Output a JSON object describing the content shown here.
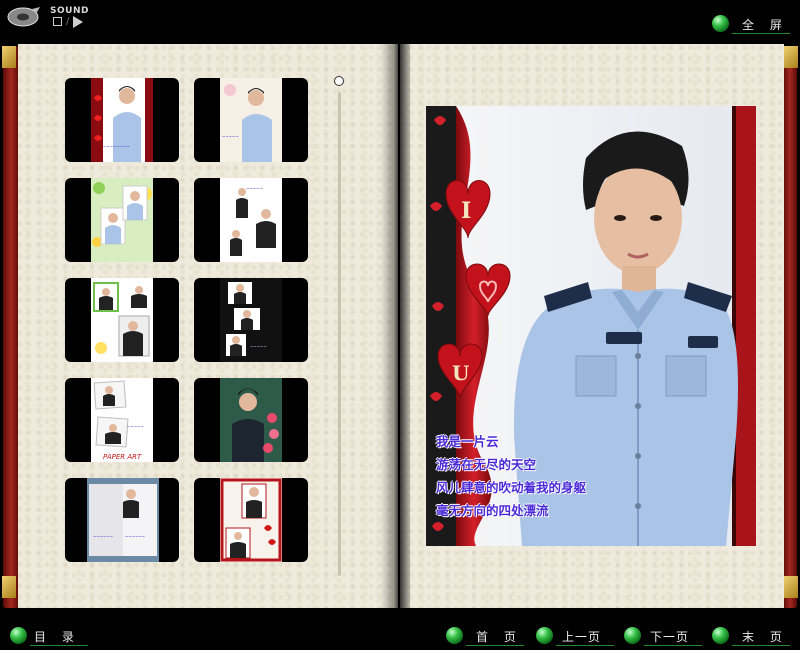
{
  "toolbar": {
    "sound_label": "SOUND",
    "fullscreen_label": "全 屏"
  },
  "gallery": {
    "thumbnails": [
      {
        "name": "thumb-1"
      },
      {
        "name": "thumb-2"
      },
      {
        "name": "thumb-3"
      },
      {
        "name": "thumb-4"
      },
      {
        "name": "thumb-5"
      },
      {
        "name": "thumb-6"
      },
      {
        "name": "thumb-7"
      },
      {
        "name": "thumb-8"
      },
      {
        "name": "thumb-9"
      },
      {
        "name": "thumb-10"
      }
    ],
    "thumb9_caption": "PAPER ART"
  },
  "photo": {
    "badge_letters": [
      "I",
      "U"
    ],
    "poem_lines": [
      "我是一片云",
      "游荡在无尽的天空",
      "风儿肆意的吹动着我的身躯",
      "毫无方向的四处漂流"
    ]
  },
  "nav": {
    "contents_label": "目 录",
    "first_label": "首 页",
    "prev_label": "上一页",
    "next_label": "下一页",
    "last_label": "末 页"
  },
  "colors": {
    "accent_green": "#39c24a",
    "poem_text": "#4a2ad8",
    "frame_red": "#b4141a",
    "uniform_blue": "#a9c4e6",
    "page_paper": "#efeadb"
  }
}
